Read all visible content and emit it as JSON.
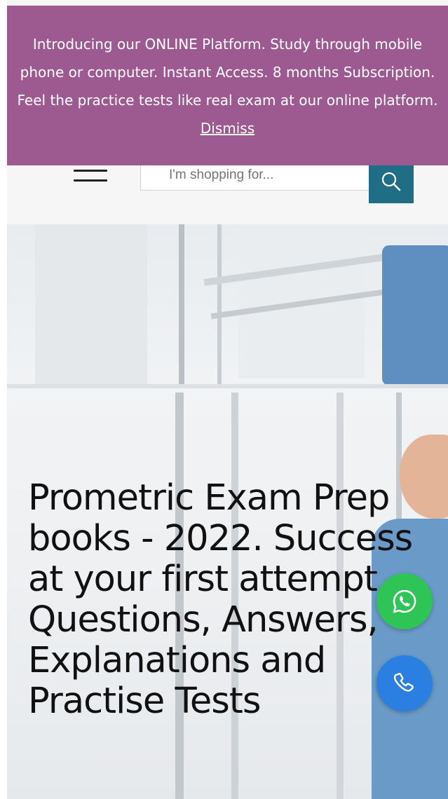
{
  "notice": {
    "text": "Introducing our ONLINE Platform. Study through mobile phone or computer. Instant Access. 8 months Subscription. Feel the practice tests like real exam at our online platform.",
    "dismiss_label": "Dismiss",
    "background": "#9c5a91"
  },
  "header": {
    "menu_icon": "hamburger-menu-icon",
    "search": {
      "placeholder": "I'm shopping for..."
    },
    "search_icon": "search-icon",
    "accent": "#1f6e85"
  },
  "hero": {
    "title": "Prometric Exam Prep books - 2022. Success at your first attempt. Questions, Answers, Explanations and Practise Tests"
  },
  "floating": {
    "whatsapp_icon": "whatsapp-icon",
    "whatsapp_color": "#2fc456",
    "phone_icon": "phone-icon",
    "phone_color": "#2b7fe0"
  }
}
